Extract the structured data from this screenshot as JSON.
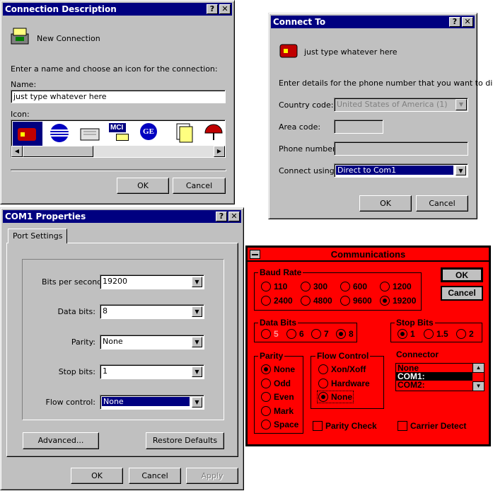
{
  "conn_desc": {
    "title": "Connection Description",
    "help": "?",
    "close": "✕",
    "connection_name_default": "New Connection",
    "instruction": "Enter a name and choose an icon for the connection:",
    "name_label": "Name:",
    "name_value": "just type whatever here",
    "icon_label": "Icon:",
    "icons": [
      "phone-icon",
      "globe-icon",
      "modem-icon",
      "mci-icon",
      "ge-icon",
      "files-icon",
      "umbrella-icon"
    ],
    "mci_text": "MCI",
    "ge_text": "GE",
    "ok": "OK",
    "cancel": "Cancel"
  },
  "connect_to": {
    "title": "Connect To",
    "help": "?",
    "close": "✕",
    "connection_name": "just type whatever here",
    "instruction": "Enter details for the phone number that you want to dial:",
    "country_label": "Country code:",
    "country_value": "United States of America (1)",
    "area_label": "Area code:",
    "area_value": "",
    "phone_label": "Phone number:",
    "phone_value": "",
    "connect_label": "Connect using:",
    "connect_value": "Direct to Com1",
    "ok": "OK",
    "cancel": "Cancel"
  },
  "com1": {
    "title": "COM1 Properties",
    "help": "?",
    "close": "✕",
    "tab": "Port Settings",
    "bits_label": "Bits per second:",
    "bits_value": "19200",
    "data_label": "Data bits:",
    "data_value": "8",
    "parity_label": "Parity:",
    "parity_value": "None",
    "stop_label": "Stop bits:",
    "stop_value": "1",
    "flow_label": "Flow control:",
    "flow_value": "None",
    "advanced": "Advanced...",
    "restore": "Restore Defaults",
    "ok": "OK",
    "cancel": "Cancel",
    "apply": "Apply"
  },
  "comm": {
    "title": "Communications",
    "baud_label": "Baud Rate",
    "baud": [
      "110",
      "300",
      "600",
      "1200",
      "2400",
      "4800",
      "9600",
      "19200"
    ],
    "ok": "OK",
    "cancel": "Cancel",
    "data_bits_label": "Data Bits",
    "data_bits": [
      "5",
      "6",
      "7",
      "8"
    ],
    "stop_bits_label": "Stop Bits",
    "stop_bits": [
      "1",
      "1.5",
      "2"
    ],
    "parity_label": "Parity",
    "parity": [
      "None",
      "Odd",
      "Even",
      "Mark",
      "Space"
    ],
    "flow_label": "Flow Control",
    "flow": [
      "Xon/Xoff",
      "Hardware",
      "None"
    ],
    "connector_label": "Connector",
    "connector": [
      "None",
      "COM1:",
      "COM2:"
    ],
    "parity_check": "Parity Check",
    "carrier_detect": "Carrier Detect",
    "accent": "#ff0000"
  }
}
